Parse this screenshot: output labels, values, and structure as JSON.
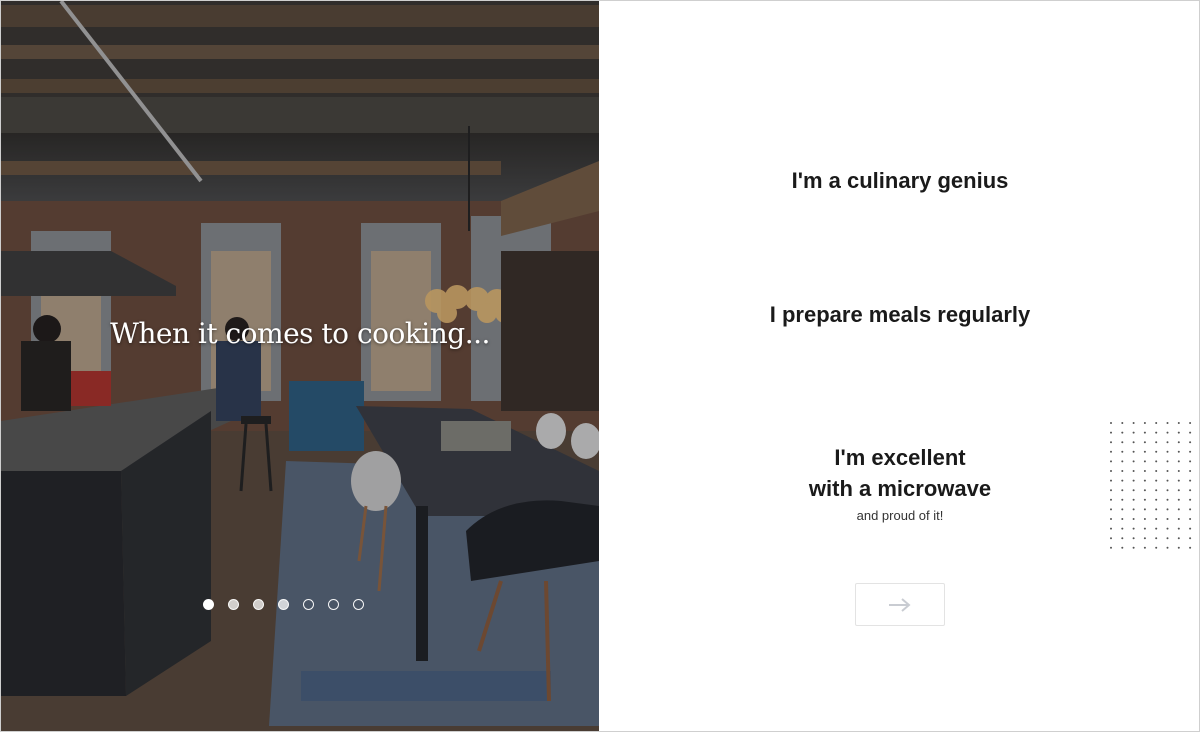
{
  "photo": {
    "caption": "When it comes to cooking...",
    "pager": {
      "total": 7,
      "current": 1,
      "seen": [
        2,
        3,
        4
      ]
    }
  },
  "options": [
    {
      "label": "I'm a culinary genius",
      "sub": ""
    },
    {
      "label": "I prepare meals regularly",
      "sub": ""
    },
    {
      "label_line1": "I'm excellent",
      "label_line2": "with a microwave",
      "sub": "and proud of it!"
    }
  ],
  "next": {
    "icon": "arrow-right-icon"
  },
  "colors": {
    "text": "#1a1a1a",
    "button_border": "#e3e3e3",
    "arrow": "#c9ccd2",
    "dot_grid": "#555555"
  }
}
